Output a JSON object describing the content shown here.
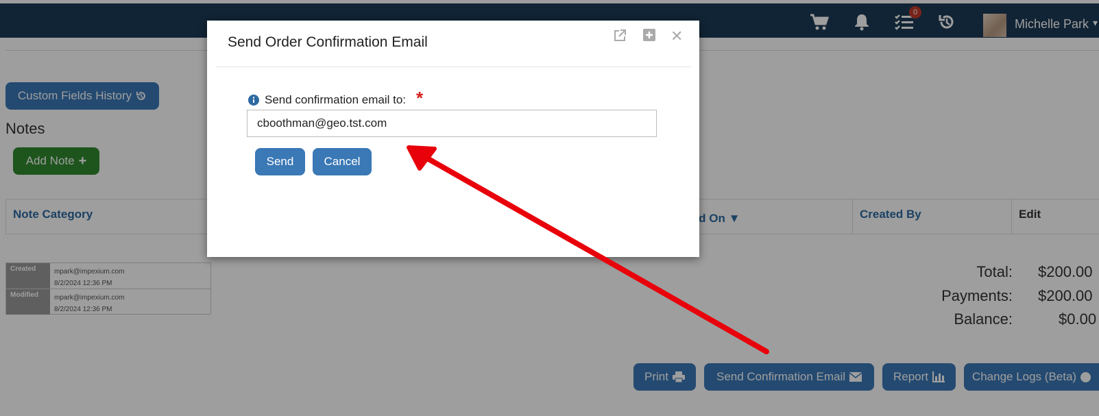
{
  "topbar": {
    "cart_icon": "shopping-cart-icon",
    "bell_icon": "bell-icon",
    "tasks_icon": "tasks-icon",
    "tasks_badge": "0",
    "history_icon": "history-icon",
    "user_name": "Michelle Park"
  },
  "page": {
    "custom_fields_history_label": "Custom Fields History",
    "notes_heading": "Notes",
    "add_note_label": "Add Note",
    "table_headers": {
      "note_category": "Note Category",
      "created_on": "ted On",
      "created_by": "Created By",
      "edit": "Edit"
    },
    "audit": {
      "created_label": "Created",
      "created_by": "mpark@impexium.com",
      "created_date": "8/2/2024 12:36 PM",
      "modified_label": "Modified",
      "modified_by": "mpark@impexium.com",
      "modified_date": "8/2/2024 12:36 PM"
    },
    "totals": {
      "total_label": "Total:",
      "total_value": "$200.00",
      "payments_label": "Payments:",
      "payments_value": "$200.00",
      "balance_label": "Balance:",
      "balance_value": "$0.00"
    },
    "actions": {
      "print": "Print",
      "send_confirmation": "Send Confirmation Email",
      "report": "Report",
      "change_logs": "Change Logs (Beta)"
    }
  },
  "modal": {
    "title": "Send Order Confirmation Email",
    "field_label": "Send confirmation email to:",
    "required_mark": "*",
    "email_value": "cboothman@geo.tst.com",
    "send_label": "Send",
    "cancel_label": "Cancel"
  },
  "colors": {
    "topbar": "#1c3a56",
    "button_blue": "#3a78b6",
    "button_green": "#2f8a2f",
    "annotation_arrow": "#e8000a"
  }
}
